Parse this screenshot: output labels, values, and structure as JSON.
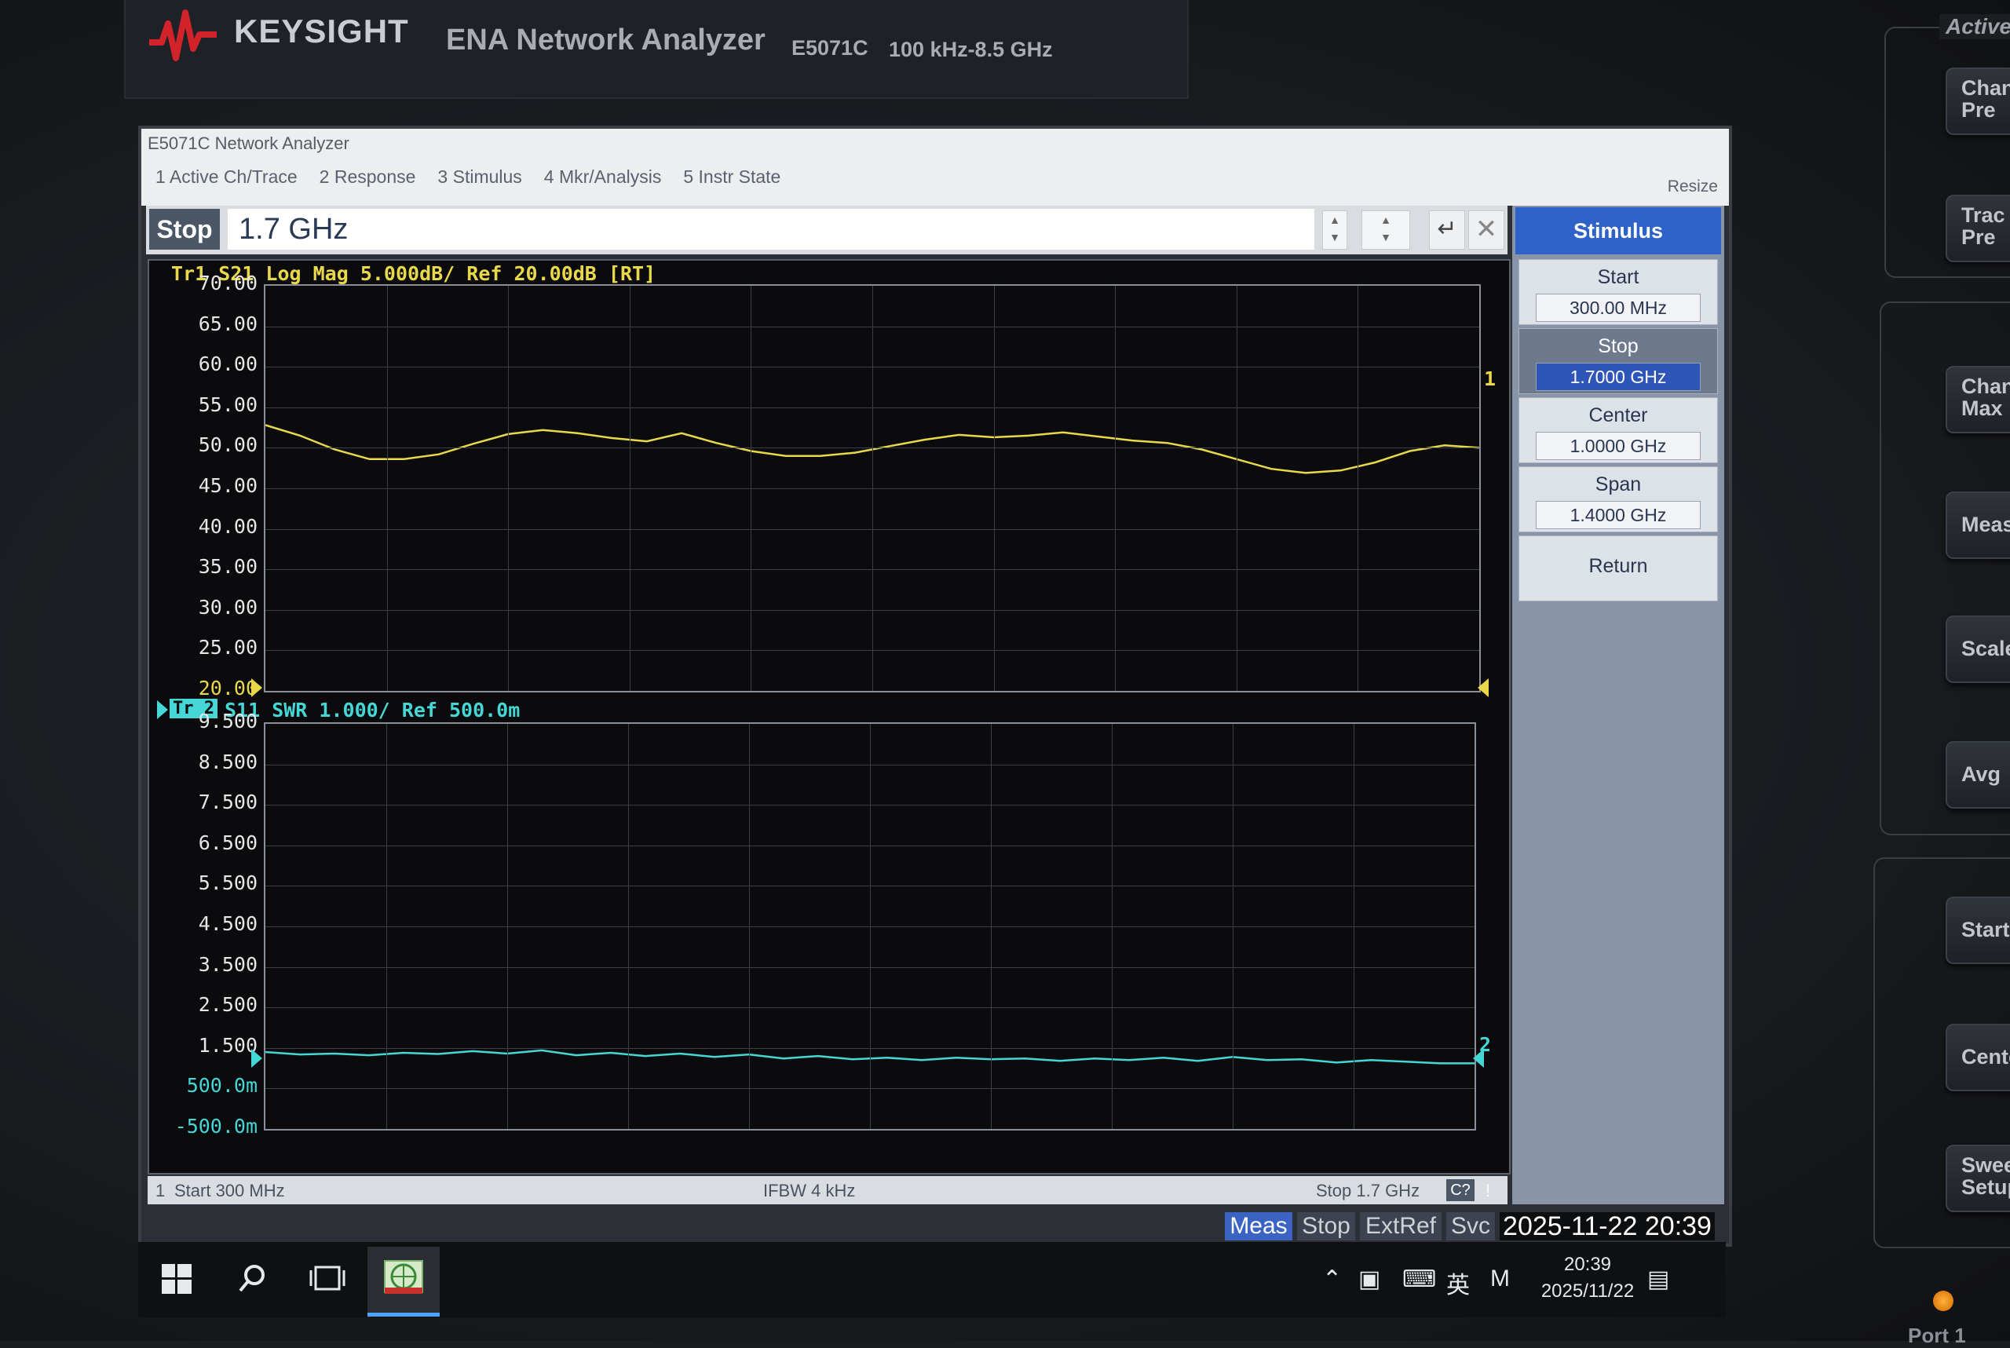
{
  "brand": {
    "name": "KEYSIGHT",
    "product": "ENA Network Analyzer",
    "model": "E5071C",
    "freq_range": "100 kHz-8.5 GHz"
  },
  "window": {
    "title": "E5071C Network Analyzer",
    "menu": [
      "1 Active Ch/Trace",
      "2 Response",
      "3 Stimulus",
      "4 Mkr/Analysis",
      "5 Instr State"
    ],
    "resize": "Resize"
  },
  "entry": {
    "label": "Stop",
    "value": "1.7 GHz"
  },
  "softkeys": {
    "title": "Stimulus",
    "items": [
      {
        "label": "Start",
        "value": "300.00 MHz"
      },
      {
        "label": "Stop",
        "value": "1.7000 GHz"
      },
      {
        "label": "Center",
        "value": "1.0000 GHz"
      },
      {
        "label": "Span",
        "value": "1.4000 GHz"
      },
      {
        "label": "Return",
        "value": ""
      }
    ]
  },
  "colors": {
    "trace1": "#e8d84a",
    "trace2": "#45d6d6",
    "accent": "#2f62c9"
  },
  "trace1": {
    "header": "Tr1 S21 Log Mag 5.000dB/ Ref 20.00dB [RT]",
    "ticks": [
      "70.00",
      "65.00",
      "60.00",
      "55.00",
      "50.00",
      "45.00",
      "40.00",
      "35.00",
      "30.00",
      "25.00",
      "20.00"
    ],
    "marker": "1"
  },
  "trace2": {
    "badge": "Tr 2",
    "header": "S11 SWR 1.000/ Ref 500.0m",
    "ticks": [
      "9.500",
      "8.500",
      "7.500",
      "6.500",
      "5.500",
      "4.500",
      "3.500",
      "2.500",
      "1.500",
      "500.0m",
      "-500.0m"
    ],
    "marker": "2"
  },
  "chart_data": [
    {
      "type": "line",
      "title": "Tr1 S21 Log Mag 5.000dB/ Ref 20.00dB [RT]",
      "xlim": [
        300,
        1700
      ],
      "ylim": [
        20,
        70
      ],
      "grid": true,
      "series": [
        {
          "name": "Tr1 S21",
          "x": [
            300,
            340,
            380,
            420,
            460,
            500,
            540,
            580,
            620,
            660,
            700,
            740,
            780,
            820,
            860,
            900,
            940,
            980,
            1020,
            1060,
            1100,
            1140,
            1180,
            1220,
            1260,
            1300,
            1340,
            1380,
            1420,
            1460,
            1500,
            1540,
            1580,
            1620,
            1660,
            1700
          ],
          "y": [
            52.8,
            51.5,
            49.8,
            48.6,
            48.6,
            49.2,
            50.5,
            51.7,
            52.2,
            51.8,
            51.2,
            50.8,
            51.8,
            50.6,
            49.6,
            49.0,
            49.0,
            49.4,
            50.2,
            51.0,
            51.6,
            51.3,
            51.5,
            51.9,
            51.4,
            50.9,
            50.6,
            49.8,
            48.6,
            47.4,
            46.9,
            47.2,
            48.2,
            49.6,
            50.3,
            50.0
          ]
        }
      ]
    },
    {
      "type": "line",
      "title": "S11 SWR 1.000/ Ref 500.0m",
      "xlim": [
        300,
        1700
      ],
      "ylim": [
        -0.5,
        9.5
      ],
      "grid": true,
      "series": [
        {
          "name": "S11",
          "x": [
            300,
            340,
            380,
            420,
            460,
            500,
            540,
            580,
            620,
            660,
            700,
            740,
            780,
            820,
            860,
            900,
            940,
            980,
            1020,
            1060,
            1100,
            1140,
            1180,
            1220,
            1260,
            1300,
            1340,
            1380,
            1420,
            1460,
            1500,
            1540,
            1580,
            1620,
            1660,
            1700
          ],
          "y": [
            1.4,
            1.34,
            1.36,
            1.32,
            1.38,
            1.35,
            1.42,
            1.36,
            1.44,
            1.32,
            1.38,
            1.3,
            1.36,
            1.28,
            1.34,
            1.24,
            1.3,
            1.22,
            1.26,
            1.2,
            1.26,
            1.22,
            1.24,
            1.18,
            1.24,
            1.2,
            1.26,
            1.18,
            1.28,
            1.2,
            1.22,
            1.14,
            1.2,
            1.16,
            1.12,
            1.12
          ]
        }
      ]
    }
  ],
  "status": {
    "channel": "1",
    "start": "Start 300 MHz",
    "ifbw": "IFBW 4 kHz",
    "stop": "Stop 1.7 GHz",
    "cal": "C?",
    "flag": "!"
  },
  "bottom_bar": {
    "items": [
      "Meas",
      "Stop",
      "ExtRef",
      "Svc"
    ],
    "datetime": "2025-11-22 20:39"
  },
  "taskbar": {
    "time": "20:39",
    "date": "2025/11/22",
    "ime": "英",
    "ime2": "M"
  },
  "hardware": {
    "group_active": "Active",
    "keys": [
      "Chan Pre",
      "Trac Pre",
      "Chann Max",
      "Meas",
      "Scale",
      "Avg",
      "Start",
      "Cente",
      "Swee Setup"
    ],
    "port": "Port 1"
  }
}
